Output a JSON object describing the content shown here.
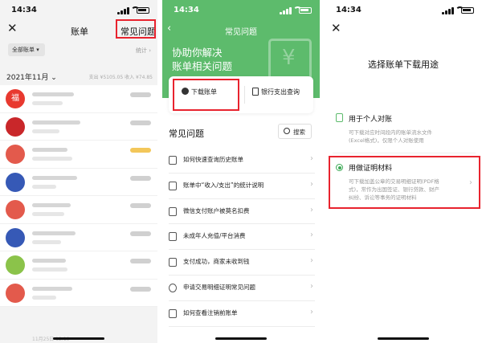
{
  "panel1": {
    "status_time": "14:34",
    "nav_title": "账单",
    "help_link": "常见问题",
    "filter_label": "全部账单",
    "stats_link": "统计",
    "month_label": "2021年11月",
    "month_summary": "支出 ¥5105.05 收入 ¥74.85",
    "footer_date": "11月25日 12:10",
    "avatar_colors": [
      "#e8392f",
      "#c9272a",
      "#e35a4c",
      "#3659b6",
      "#e35a4c",
      "#3659b6",
      "#8bc34a",
      "#e35a4c"
    ],
    "avatar_badge": "福",
    "highlight_color": "#e8232e"
  },
  "panel2": {
    "status_time": "14:34",
    "title": "常见问题",
    "headline_1": "协助你解决",
    "headline_2": "账单相关问题",
    "download_btn": "下载账单",
    "bank_btn": "银行支出查询",
    "faq_title": "常见问题",
    "search_label": "搜索",
    "faq_items": [
      "如何快速查询历史账单",
      "账单中“收入/支出”的统计说明",
      "微信支付账户被莫名扣费",
      "未成年人充值/平台消费",
      "支付成功，商家未收到钱",
      "申请交易明细证明常见问题",
      "如何查看注销前账单"
    ],
    "accent_color": "#5dbb6c"
  },
  "panel3": {
    "status_time": "14:34",
    "title": "选择账单下载用途",
    "option1_title": "用于个人对账",
    "option1_desc_1": "可下载对应时间段内的账单流水文件",
    "option1_desc_2": "(Excel格式)，仅限个人对账使用",
    "option2_title": "用做证明材料",
    "option2_desc_1": "可下载加盖公章的交易明细证明(PDF格",
    "option2_desc_2": "式)，常作为出国签证、银行贷款、财产",
    "option2_desc_3": "纠纷、诉讼等事务的证明材料"
  }
}
